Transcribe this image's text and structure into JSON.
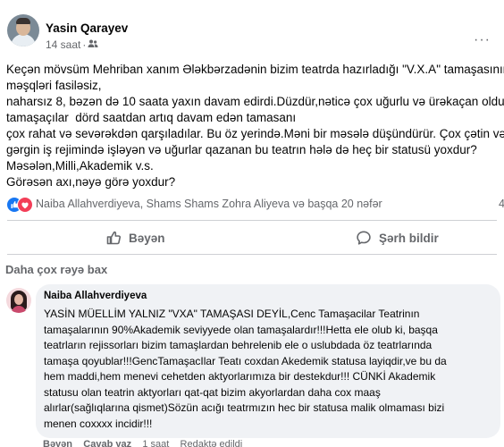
{
  "post": {
    "author": "Yasin Qarayev",
    "time": "14 saat",
    "dot": "·",
    "menu": "···",
    "body": "Keçən mövsüm Mehriban xanım Ələkbərzadənin bizim teatrda hazırladığı \"V.X.A\" tamaşasının\nməşqləri fasiləsiz,\nnaharsız 8, bəzən də 10 saata yaxın davam edirdi.Düzdür,nəticə çox uğurlu və ürəkaçan oldu.Və\ntamaşaçılar  dörd saatdan artıq davam edən tamasanı\nçox rahat və sevərəkdən qarşıladılar. Bu öz yerində.Məni bir məsələ düşündürür. Çox çətin və\ngərgin iş rejimində işləyən və uğurlar qazanan bu teatrın hələ də heç bir statusü yoxdur?\nMəsələn,Milli,Akademik v.s.\nGörəsən axı,nəyə görə yoxdur?"
  },
  "reactions": {
    "text": "Naiba Allahverdiyeva, Shams Shams Zohra Aliyeva və başqa 20 nəfər",
    "count_partial": "4",
    "icons": [
      "like-icon",
      "love-icon"
    ]
  },
  "actions": {
    "like": "Bəyən",
    "share": "Şərh bildir"
  },
  "more_comments": "Daha çox rəyə bax",
  "comment": {
    "author": "Naiba Allahverdiyeva",
    "text": "YASİN MÜELLİM YALNIZ \"VXA\" TAMAŞASI DEYİL,Cenc Tamaşacilar Teatrinın\ntamaşalarının 90%Akademik seviyyede olan tamaşalardır!!!Hetta ele olub ki, başqa\nteatrların rejissorları bizim tamaşlardan behrelenib ele o uslubdada öz teatrlarında\ntamaşa qoyublar!!!GencTamaşacIlar Teatı coxdan Akedemik statusa layiqdir,ve bu da\nhem maddi,hem menevi cehetden aktyorlarımıza bir destekdur!!! CÜNKİ Akademik\nstatusu olan teatrin aktyorları qat-qat bizim akyorlardan daha cox maaş\nalırlar(sağlıqlarına qismet)Sözün acığı teatrmızın hec bir statusa malik olmaması bizi\nmenen coxxxx incidir!!!",
    "footer": {
      "like": "Bəyən",
      "reply": "Cavab yaz",
      "time": "1 saat",
      "edited": "Redaktə edildi"
    }
  }
}
